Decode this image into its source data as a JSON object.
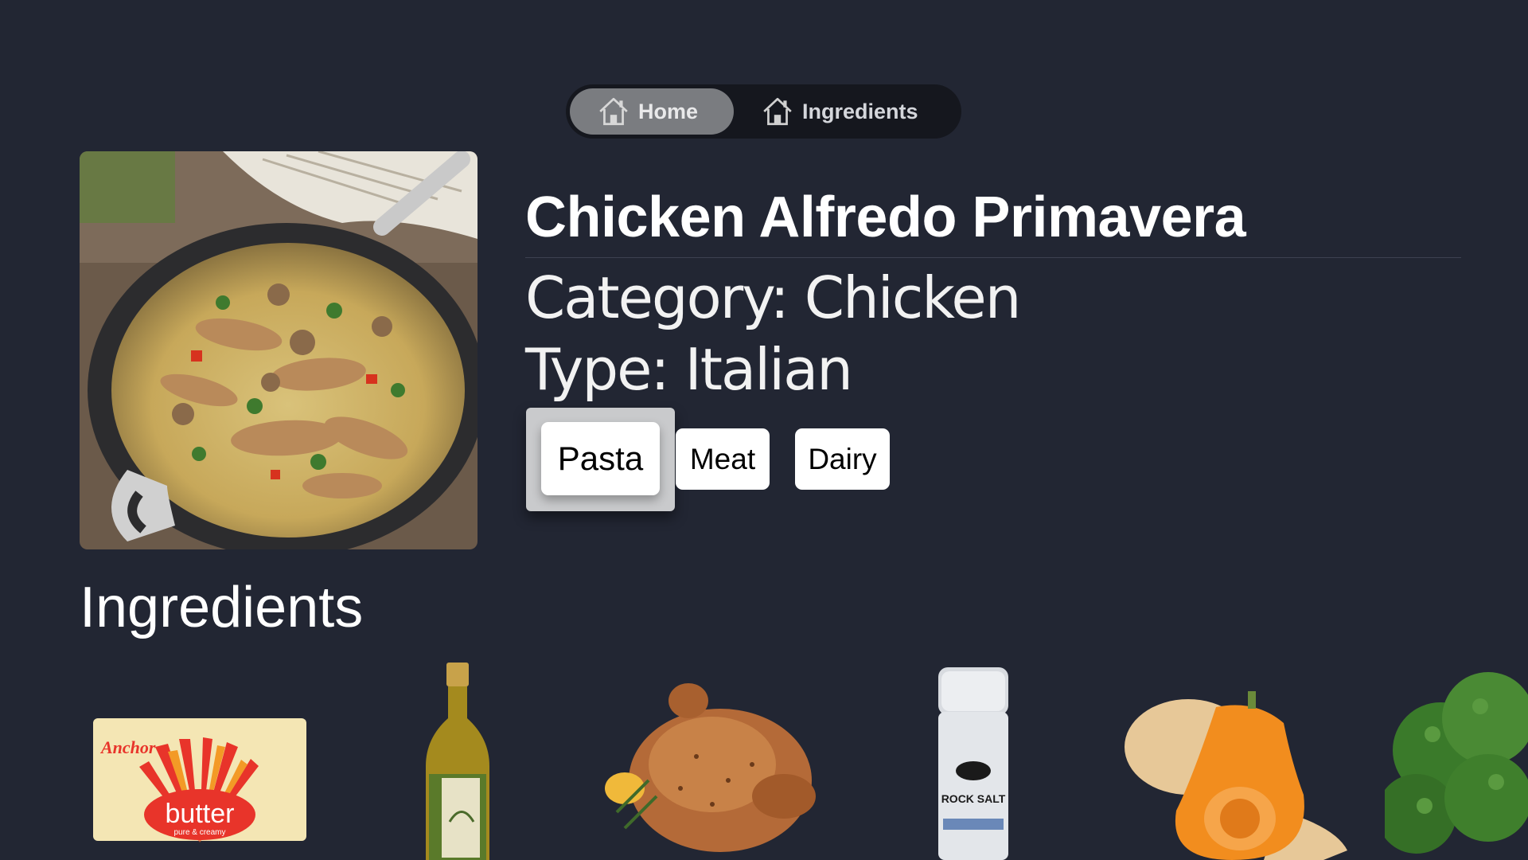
{
  "nav": {
    "tabs": [
      {
        "label": "Home",
        "icon": "home-icon",
        "active": true
      },
      {
        "label": "Ingredients",
        "icon": "home-icon",
        "active": false
      }
    ]
  },
  "recipe": {
    "title": "Chicken Alfredo Primavera",
    "category": "Category: Chicken",
    "type": "Type: Italian",
    "tags": [
      "Pasta",
      "Meat",
      "Dairy"
    ],
    "focused_tag": "Pasta"
  },
  "ingredients": {
    "heading": "Ingredients",
    "items": [
      {
        "name": "butter",
        "icon": "butter-image",
        "label_on_pack": "butter",
        "brand_on_pack": "Anchor",
        "subtext_on_pack": "pure & creamy"
      },
      {
        "name": "olive oil",
        "icon": "olive-oil-image"
      },
      {
        "name": "chicken",
        "icon": "roast-chicken-image"
      },
      {
        "name": "salt",
        "icon": "rock-salt-image",
        "label_on_pack": "ROCK SALT"
      },
      {
        "name": "butternut squash",
        "icon": "squash-image"
      },
      {
        "name": "broccoli",
        "icon": "broccoli-image"
      }
    ]
  },
  "colors": {
    "background": "#222633",
    "nav_bg": "#15171e",
    "nav_active": "#7a7c80",
    "tag_bg": "#ffffff"
  }
}
